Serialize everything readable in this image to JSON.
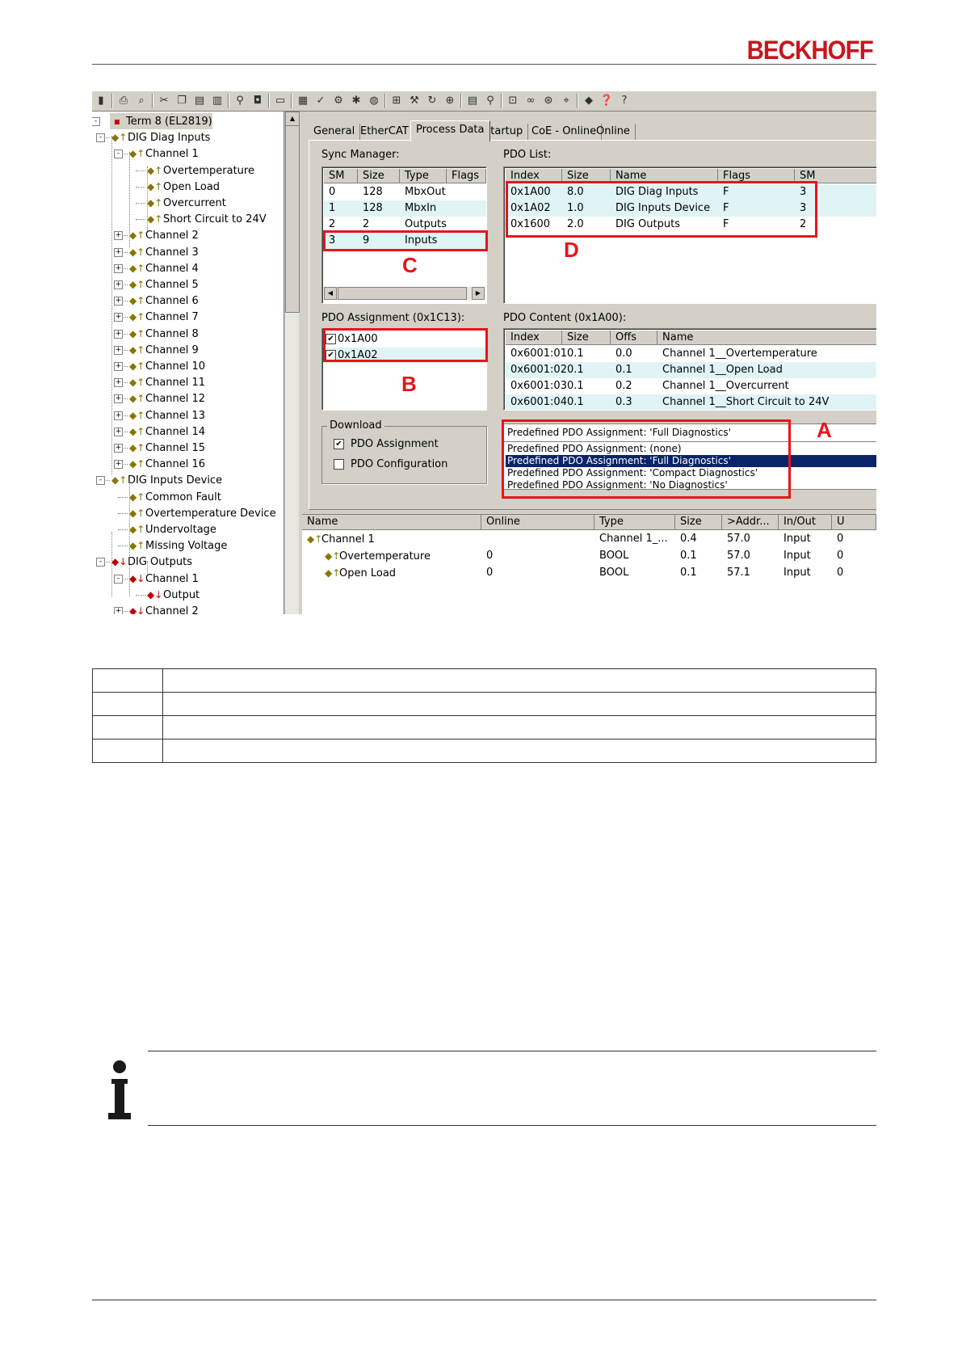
{
  "header": {
    "logo_text": "BECKHOFF",
    "logo_color": "#c8161d"
  },
  "toolbar": {
    "icons": [
      "new-icon",
      "print-icon",
      "print-preview-icon",
      "cut-icon",
      "copy-icon",
      "paste-icon",
      "paste-special-icon",
      "find-icon",
      "mouse-icon",
      "monitor-icon",
      "network-icon",
      "check-icon",
      "build-icon",
      "activate-icon",
      "globe-icon",
      "config-icon",
      "tools-icon",
      "refresh-icon",
      "scan-icon",
      "document-icon",
      "zoom-icon",
      "device-icon",
      "binoculars-icon",
      "target-icon",
      "trace-icon",
      "book-icon",
      "help-icon",
      "question-icon"
    ]
  },
  "tree": {
    "items": [
      {
        "label": "Term 8 (EL2819)",
        "level": 0,
        "toggle": "-",
        "kind": "term",
        "selected": true
      },
      {
        "label": "DIG Diag Inputs",
        "level": 1,
        "toggle": "-",
        "kind": "in"
      },
      {
        "label": "Channel 1",
        "level": 2,
        "toggle": "-",
        "kind": "in"
      },
      {
        "label": "Overtemperature",
        "level": 3,
        "toggle": "",
        "kind": "in"
      },
      {
        "label": "Open Load",
        "level": 3,
        "toggle": "",
        "kind": "in"
      },
      {
        "label": "Overcurrent",
        "level": 3,
        "toggle": "",
        "kind": "in"
      },
      {
        "label": "Short Circuit to 24V",
        "level": 3,
        "toggle": "",
        "kind": "in"
      },
      {
        "label": "Channel 2",
        "level": 2,
        "toggle": "+",
        "kind": "in"
      },
      {
        "label": "Channel 3",
        "level": 2,
        "toggle": "+",
        "kind": "in"
      },
      {
        "label": "Channel 4",
        "level": 2,
        "toggle": "+",
        "kind": "in"
      },
      {
        "label": "Channel 5",
        "level": 2,
        "toggle": "+",
        "kind": "in"
      },
      {
        "label": "Channel 6",
        "level": 2,
        "toggle": "+",
        "kind": "in"
      },
      {
        "label": "Channel 7",
        "level": 2,
        "toggle": "+",
        "kind": "in"
      },
      {
        "label": "Channel 8",
        "level": 2,
        "toggle": "+",
        "kind": "in"
      },
      {
        "label": "Channel 9",
        "level": 2,
        "toggle": "+",
        "kind": "in"
      },
      {
        "label": "Channel 10",
        "level": 2,
        "toggle": "+",
        "kind": "in"
      },
      {
        "label": "Channel 11",
        "level": 2,
        "toggle": "+",
        "kind": "in"
      },
      {
        "label": "Channel 12",
        "level": 2,
        "toggle": "+",
        "kind": "in"
      },
      {
        "label": "Channel 13",
        "level": 2,
        "toggle": "+",
        "kind": "in"
      },
      {
        "label": "Channel 14",
        "level": 2,
        "toggle": "+",
        "kind": "in"
      },
      {
        "label": "Channel 15",
        "level": 2,
        "toggle": "+",
        "kind": "in"
      },
      {
        "label": "Channel 16",
        "level": 2,
        "toggle": "+",
        "kind": "in"
      },
      {
        "label": "DIG Inputs Device",
        "level": 1,
        "toggle": "-",
        "kind": "in"
      },
      {
        "label": "Common Fault",
        "level": 2,
        "toggle": "",
        "kind": "in"
      },
      {
        "label": "Overtemperature Device",
        "level": 2,
        "toggle": "",
        "kind": "in"
      },
      {
        "label": "Undervoltage",
        "level": 2,
        "toggle": "",
        "kind": "in"
      },
      {
        "label": "Missing Voltage",
        "level": 2,
        "toggle": "",
        "kind": "in"
      },
      {
        "label": "DIG Outputs",
        "level": 1,
        "toggle": "-",
        "kind": "out"
      },
      {
        "label": "Channel 1",
        "level": 2,
        "toggle": "-",
        "kind": "out"
      },
      {
        "label": "Output",
        "level": 3,
        "toggle": "",
        "kind": "out"
      },
      {
        "label": "Channel 2",
        "level": 2,
        "toggle": "+",
        "kind": "out"
      }
    ]
  },
  "tabs": [
    "General",
    "EtherCAT",
    "Process Data",
    "Startup",
    "CoE - Online",
    "Online"
  ],
  "active_tab": "Process Data",
  "sync_manager": {
    "label": "Sync Manager:",
    "columns": [
      "SM",
      "Size",
      "Type",
      "Flags"
    ],
    "rows": [
      [
        "0",
        "128",
        "MbxOut",
        ""
      ],
      [
        "1",
        "128",
        "MbxIn",
        ""
      ],
      [
        "2",
        "2",
        "Outputs",
        ""
      ],
      [
        "3",
        "9",
        "Inputs",
        ""
      ]
    ]
  },
  "pdo_list": {
    "label": "PDO List:",
    "columns": [
      "Index",
      "Size",
      "Name",
      "Flags",
      "SM"
    ],
    "rows": [
      [
        "0x1A00",
        "8.0",
        "DIG Diag Inputs",
        "F",
        "3"
      ],
      [
        "0x1A02",
        "1.0",
        "DIG Inputs Device",
        "F",
        "3"
      ],
      [
        "0x1600",
        "2.0",
        "DIG Outputs",
        "F",
        "2"
      ]
    ]
  },
  "pdo_assignment": {
    "label": "PDO Assignment (0x1C13):",
    "items": [
      "0x1A00",
      "0x1A02"
    ]
  },
  "pdo_content": {
    "label": "PDO Content (0x1A00):",
    "columns": [
      "Index",
      "Size",
      "Offs",
      "Name"
    ],
    "rows": [
      [
        "0x6001:01",
        "0.1",
        "0.0",
        "Channel 1__Overtemperature"
      ],
      [
        "0x6001:02",
        "0.1",
        "0.1",
        "Channel 1__Open Load"
      ],
      [
        "0x6001:03",
        "0.1",
        "0.2",
        "Channel 1__Overcurrent"
      ],
      [
        "0x6001:04",
        "0.1",
        "0.3",
        "Channel 1__Short Circuit to 24V"
      ]
    ]
  },
  "download": {
    "title": "Download",
    "options": [
      {
        "label": "PDO Assignment",
        "checked": true
      },
      {
        "label": "PDO Configuration",
        "checked": false
      }
    ]
  },
  "predefined": {
    "current": "Predefined PDO Assignment: 'Full Diagnostics'",
    "options": [
      "Predefined PDO Assignment: (none)",
      "Predefined PDO Assignment: 'Full Diagnostics'",
      "Predefined PDO Assignment: 'Compact Diagnostics'",
      "Predefined PDO Assignment: 'No Diagnostics'"
    ],
    "selected_index": 1
  },
  "markers": {
    "a": "A",
    "b": "B",
    "c": "C",
    "d": "D",
    "color": "#e8141b"
  },
  "var_grid": {
    "columns": [
      "Name",
      "Online",
      "Type",
      "Size",
      ">Addr...",
      "In/Out",
      "U"
    ],
    "rows": [
      [
        "Channel 1",
        "",
        "Channel 1_...",
        "0.4",
        "57.0",
        "Input",
        "0"
      ],
      [
        "Overtemperature",
        "0",
        "BOOL",
        "0.1",
        "57.0",
        "Input",
        "0"
      ],
      [
        "Open Load",
        "0",
        "BOOL",
        "0.1",
        "57.1",
        "Input",
        "0"
      ]
    ]
  },
  "doc_table": {
    "rows": 4
  }
}
